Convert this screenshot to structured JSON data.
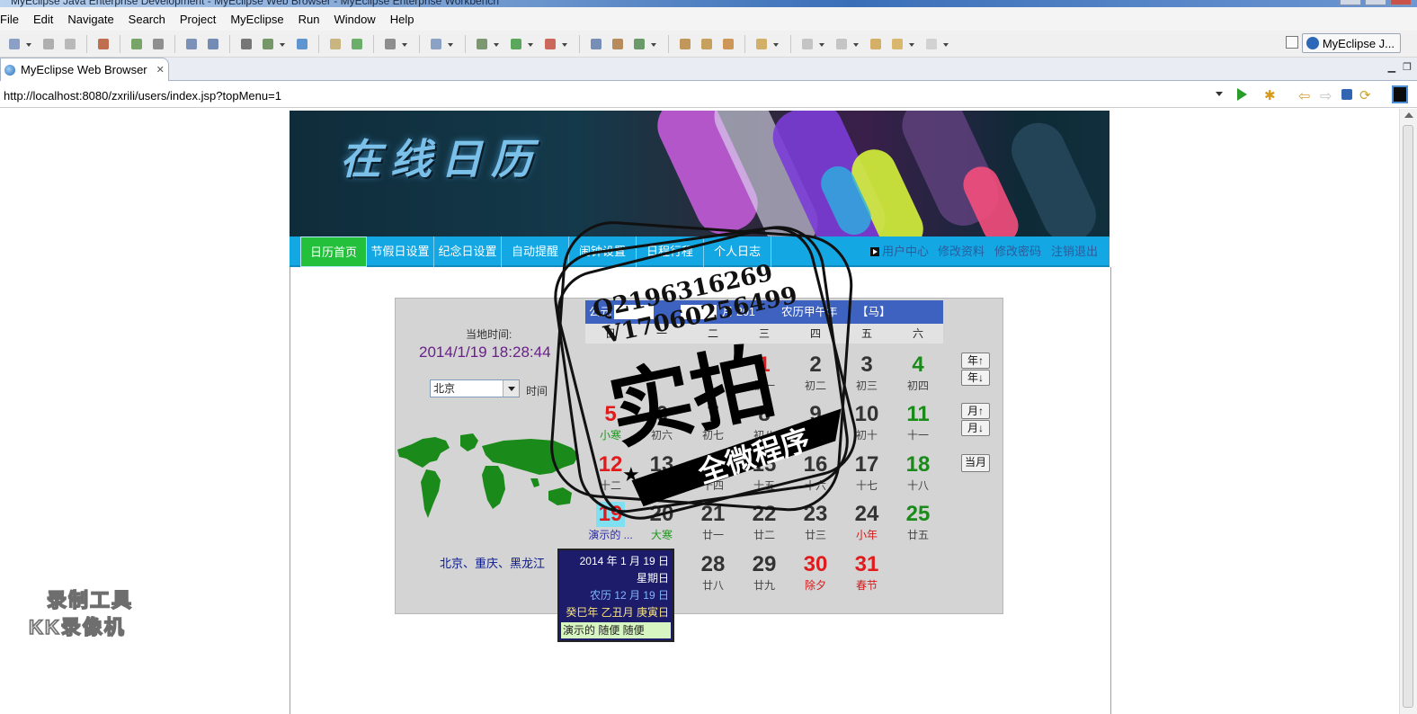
{
  "window": {
    "title": "MyEclipse Java Enterprise Development - MyEclipse Web Browser - MyEclipse Enterprise Workbench"
  },
  "menubar": [
    "File",
    "Edit",
    "Navigate",
    "Search",
    "Project",
    "MyEclipse",
    "Run",
    "Window",
    "Help"
  ],
  "toolbar": {
    "perspective_label": "MyEclipse J..."
  },
  "editor_tab": {
    "label": "MyEclipse Web Browser",
    "close_icon": "close-icon"
  },
  "address_bar": {
    "url": "http://localhost:8080/zxrili/users/index.jsp?topMenu=1"
  },
  "site": {
    "title": "在线日历",
    "nav": [
      "日历首页",
      "节假日设置",
      "纪念日设置",
      "自动提醒",
      "闹钟设置",
      "日程行程",
      "个人日志"
    ],
    "nav_active": "日历首页",
    "nav_right": [
      "用户中心",
      "修改资料",
      "修改密码",
      "注销退出"
    ]
  },
  "clock": {
    "label": "当地时间:",
    "value": "2014/1/19 18:28:44",
    "city": "北京",
    "time_label": "时间",
    "regions": "北京、重庆、黑龙江"
  },
  "calendar": {
    "header": {
      "prefix": "公元",
      "month_label": "月",
      "year_text": "201",
      "lunar": "农历甲午年",
      "zodiac": "【马】"
    },
    "weekdays": [
      "日",
      "一",
      "二",
      "三",
      "四",
      "五",
      "六"
    ],
    "weeks": [
      [
        null,
        null,
        null,
        {
          "d": "1",
          "l": "初一"
        },
        {
          "d": "2",
          "l": "初二"
        },
        {
          "d": "3",
          "l": "初三"
        },
        {
          "d": "4",
          "l": "初四"
        }
      ],
      [
        {
          "d": "5",
          "l": "小寒"
        },
        {
          "d": "6",
          "l": "初六"
        },
        {
          "d": "7",
          "l": "初七"
        },
        {
          "d": "8",
          "l": "初八"
        },
        {
          "d": "9",
          "l": "初九"
        },
        {
          "d": "10",
          "l": "初十"
        },
        {
          "d": "11",
          "l": "十一"
        }
      ],
      [
        {
          "d": "12",
          "l": "十二"
        },
        {
          "d": "13",
          "l": "十三"
        },
        {
          "d": "14",
          "l": "十四"
        },
        {
          "d": "15",
          "l": "十五"
        },
        {
          "d": "16",
          "l": "十六"
        },
        {
          "d": "17",
          "l": "十七"
        },
        {
          "d": "18",
          "l": "十八"
        }
      ],
      [
        {
          "d": "19",
          "l": "演示的 ..."
        },
        {
          "d": "20",
          "l": "大寒"
        },
        {
          "d": "21",
          "l": "廿一"
        },
        {
          "d": "22",
          "l": "廿二"
        },
        {
          "d": "23",
          "l": "廿三"
        },
        {
          "d": "24",
          "l": "小年"
        },
        {
          "d": "25",
          "l": "廿五"
        }
      ],
      [
        null,
        null,
        {
          "d": "28",
          "l": "廿八"
        },
        {
          "d": "29",
          "l": "廿九"
        },
        {
          "d": "30",
          "l": "除夕"
        },
        {
          "d": "31",
          "l": "春节"
        },
        null
      ]
    ],
    "controls": [
      "年↑",
      "年↓",
      "月↑",
      "月↓",
      "当月"
    ],
    "colors": {
      "sunday": "#e11b1b",
      "saturday": "#1a8a1a",
      "holiday": "#e11b1b",
      "normal": "#333333",
      "today_bg": "#7ee0f0"
    }
  },
  "tooltip": {
    "date": "2014 年 1 月 19 日",
    "weekday": "星期日",
    "lunar_date": "农历 12 月 19 日",
    "ganzhi": "癸巳年 乙丑月 庚寅日",
    "note": "演示的 随便 随便"
  },
  "watermark": {
    "qq": "Q2196316269",
    "vx": "V17060256499",
    "main": "实拍",
    "ribbon": "全微程序",
    "recorder_line1": "录制工具",
    "recorder_line2": "KK录像机"
  }
}
